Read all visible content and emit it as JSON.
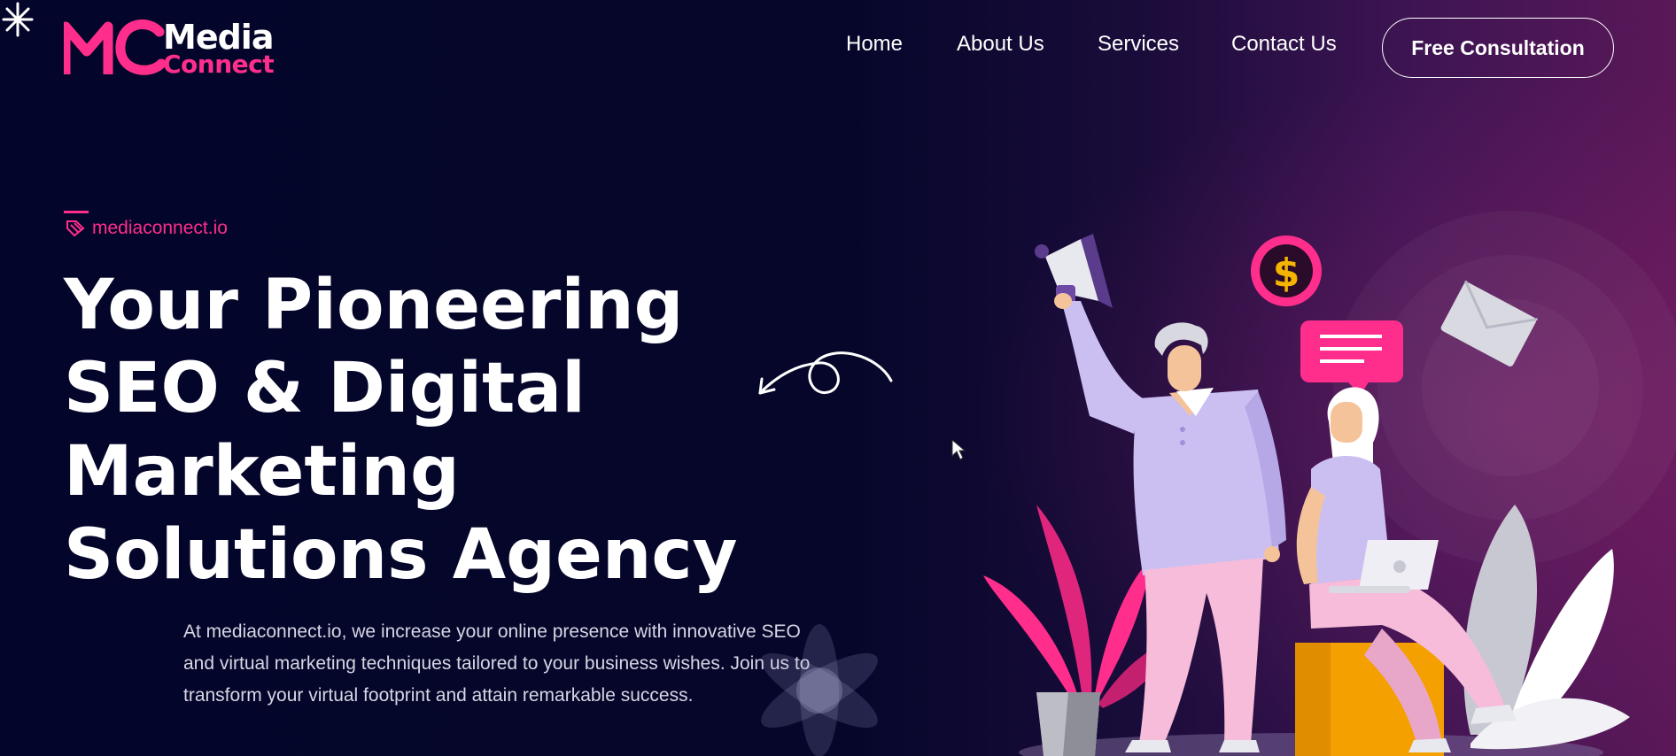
{
  "brand": {
    "logo_line1": "Media",
    "logo_line2": "Connect",
    "accent_color": "#ff2e8c"
  },
  "nav": {
    "items": [
      {
        "label": "Home"
      },
      {
        "label": "About Us"
      },
      {
        "label": "Services"
      },
      {
        "label": "Contact Us"
      }
    ],
    "cta_label": "Free Consultation"
  },
  "hero": {
    "badge_label": "mediaconnect.io",
    "headline_lines": [
      "Your Pioneering",
      "SEO & Digital",
      "Marketing",
      "Solutions Agency"
    ],
    "paragraph_lines": [
      "At mediaconnect.io, we increase your online presence with innovative SEO",
      "and virtual marketing techniques tailored to your business wishes. Join us to",
      "transform your virtual footprint and attain remarkable success."
    ]
  },
  "illustration": {
    "currency_symbol": "$"
  },
  "icons": [
    "sparkle-icon",
    "logo-mark-icon",
    "badge-icon",
    "arrow-doodle-icon",
    "star-decoration-icon",
    "cursor-icon",
    "megaphone-icon",
    "dollar-coin-icon",
    "chat-bubble-icon",
    "envelope-icon",
    "laptop-icon"
  ]
}
